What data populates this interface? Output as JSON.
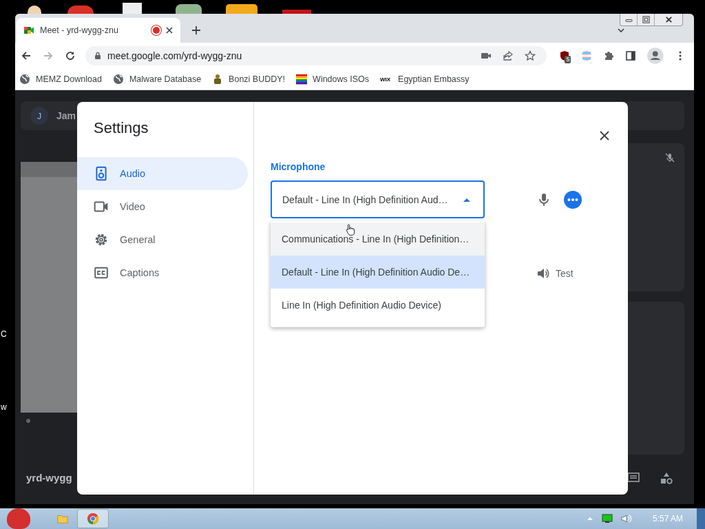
{
  "desktop": {
    "icon_labels": [
      "C",
      "w"
    ]
  },
  "browser": {
    "tab": {
      "title": "Meet - yrd-wygg-znu",
      "recording": true
    },
    "address": "meet.google.com/yrd-wygg-znu",
    "extension_badge": "5",
    "bookmarks": [
      {
        "label": "MEMZ Download"
      },
      {
        "label": "Malware Database"
      },
      {
        "label": "Bonzi BUDDY!"
      },
      {
        "label": "Windows ISOs"
      },
      {
        "label": "Egyptian Embassy",
        "favicon_text": "WIX"
      }
    ]
  },
  "meeting": {
    "participant_initial": "J",
    "participant_name": "Jam",
    "meeting_code": "yrd-wygg"
  },
  "settings": {
    "title": "Settings",
    "nav": [
      {
        "label": "Audio",
        "selected": true
      },
      {
        "label": "Video",
        "selected": false
      },
      {
        "label": "General",
        "selected": false
      },
      {
        "label": "Captions",
        "selected": false
      }
    ],
    "microphone": {
      "label": "Microphone",
      "value": "Default - Line In (High Definition Aud…",
      "expanded": true,
      "options": [
        {
          "label": "Communications - Line In (High Definition…",
          "selected": false,
          "hovered": true
        },
        {
          "label": "Default - Line In (High Definition Audio De…",
          "selected": true,
          "hovered": false
        },
        {
          "label": "Line In (High Definition Audio Device)",
          "selected": false,
          "hovered": false
        }
      ]
    },
    "speaker_test": "Test"
  },
  "taskbar": {
    "time": "5:57 AM"
  }
}
